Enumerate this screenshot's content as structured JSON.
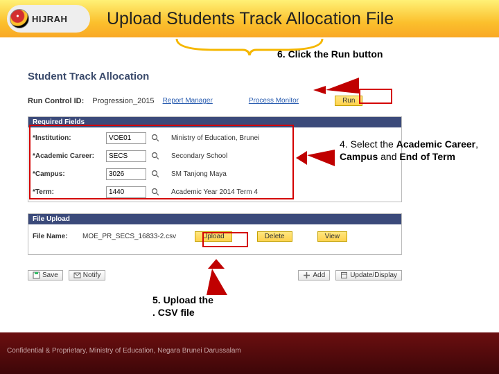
{
  "header": {
    "logo_text": "HIJRAH",
    "slide_title": "Upload Students Track Allocation File"
  },
  "page": {
    "title": "Student Track Allocation",
    "run_control_label": "Run Control ID:",
    "run_control_value": "Progression_2015",
    "link_report_manager": "Report Manager",
    "link_process_monitor": "Process Monitor",
    "run_button": "Run"
  },
  "required": {
    "header": "Required Fields",
    "institution_label": "*Institution:",
    "institution_value": "VOE01",
    "institution_desc": "Ministry of Education, Brunei",
    "career_label": "*Academic Career:",
    "career_value": "SECS",
    "career_desc": "Secondary School",
    "campus_label": "*Campus:",
    "campus_value": "3026",
    "campus_desc": "SM Tanjong Maya",
    "term_label": "*Term:",
    "term_value": "1440",
    "term_desc": "Academic Year 2014 Term 4"
  },
  "file_upload": {
    "header": "File Upload",
    "filename_label": "File Name:",
    "filename_value": "MOE_PR_SECS_16833-2.csv",
    "upload_button": "Upload",
    "delete_button": "Delete",
    "view_button": "View"
  },
  "bottom": {
    "save": "Save",
    "notify": "Notify",
    "add": "Add",
    "update_display": "Update/Display"
  },
  "callouts": {
    "step6": "6. Click the Run button",
    "step4_part1": "4. Select the ",
    "step4_bold1": "Academic Career",
    "step4_sep1": ", ",
    "step4_bold2": "Campus",
    "step4_sep2": " and ",
    "step4_bold3": "End of Term",
    "step5_line1": "5. Upload the",
    "step5_line2": ". CSV file"
  },
  "footer": {
    "text": "Confidential & Proprietary, Ministry of Education, Negara Brunei Darussalam"
  }
}
